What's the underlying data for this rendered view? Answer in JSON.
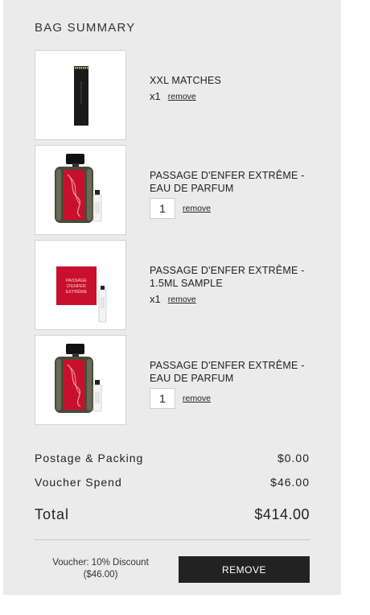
{
  "summary": {
    "title": "BAG SUMMARY"
  },
  "items": [
    {
      "name": "XXL MATCHES",
      "qty_label": "x1",
      "remove_label": "remove",
      "image_icon": "matchbox-image"
    },
    {
      "name": "PASSAGE D'ENFER EXTRÊME - EAU DE PARFUM",
      "qty_value": "1",
      "remove_label": "remove",
      "image_icon": "perfume-bottle-image"
    },
    {
      "name": "PASSAGE D'ENFER EXTRÊME - 1.5ML SAMPLE",
      "qty_label": "x1",
      "remove_label": "remove",
      "image_icon": "sample-card-image",
      "card_text": [
        "PASSAGE",
        "D'ENFER",
        "EXTRÊME"
      ]
    },
    {
      "name": "PASSAGE D'ENFER EXTRÊME - EAU DE PARFUM",
      "qty_value": "1",
      "remove_label": "remove",
      "image_icon": "perfume-bottle-image"
    }
  ],
  "totals": {
    "postage_label": "Postage & Packing",
    "postage_value": "$0.00",
    "voucher_label": "Voucher Spend",
    "voucher_value": "$46.00",
    "total_label": "Total",
    "total_value": "$414.00"
  },
  "voucher": {
    "description": "Voucher: 10% Discount",
    "amount": "($46.00)",
    "remove_button": "REMOVE"
  },
  "colors": {
    "panel_bg": "#ebebeb",
    "button_bg": "#222222",
    "perfume_red": "#c8102e"
  }
}
